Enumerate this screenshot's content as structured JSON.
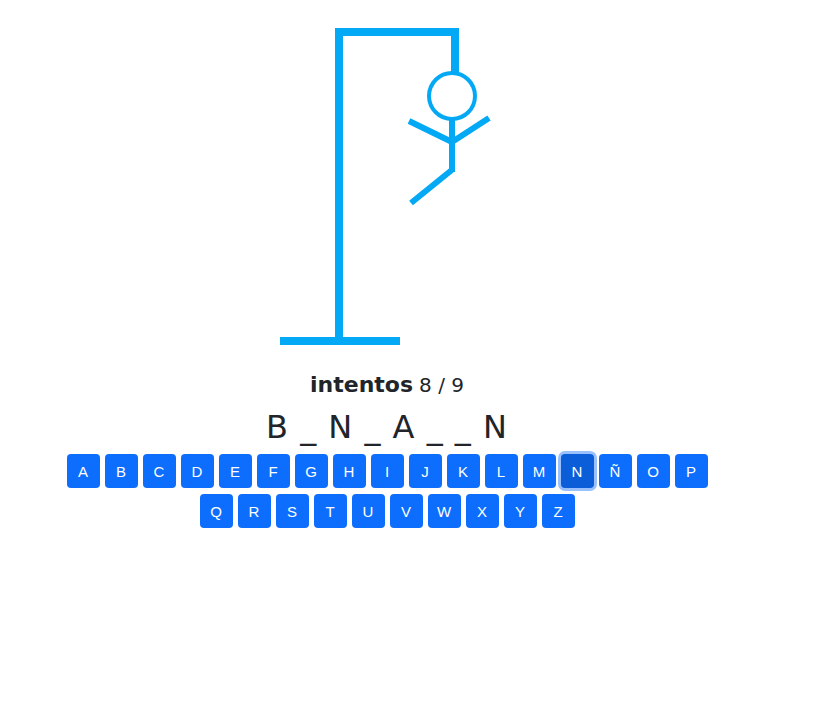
{
  "hangman": {
    "parts": [
      {
        "name": "head",
        "drawn": true
      },
      {
        "name": "body",
        "drawn": true
      },
      {
        "name": "left-arm",
        "drawn": true
      },
      {
        "name": "right-arm",
        "drawn": true
      },
      {
        "name": "left-leg",
        "drawn": true
      },
      {
        "name": "right-leg",
        "drawn": false
      }
    ]
  },
  "attempts": {
    "label": "intentos",
    "count": "8 / 9"
  },
  "word": "B _ N _ A _ _ N",
  "keyboard": {
    "rows": [
      [
        {
          "letter": "A",
          "selected": false
        },
        {
          "letter": "B",
          "selected": false
        },
        {
          "letter": "C",
          "selected": false
        },
        {
          "letter": "D",
          "selected": false
        },
        {
          "letter": "E",
          "selected": false
        },
        {
          "letter": "F",
          "selected": false
        },
        {
          "letter": "G",
          "selected": false
        },
        {
          "letter": "H",
          "selected": false
        },
        {
          "letter": "I",
          "selected": false
        },
        {
          "letter": "J",
          "selected": false
        },
        {
          "letter": "K",
          "selected": false
        },
        {
          "letter": "L",
          "selected": false
        },
        {
          "letter": "M",
          "selected": false
        },
        {
          "letter": "N",
          "selected": true
        },
        {
          "letter": "Ñ",
          "selected": false
        },
        {
          "letter": "O",
          "selected": false
        },
        {
          "letter": "P",
          "selected": false
        }
      ],
      [
        {
          "letter": "Q",
          "selected": false
        },
        {
          "letter": "R",
          "selected": false
        },
        {
          "letter": "S",
          "selected": false
        },
        {
          "letter": "T",
          "selected": false
        },
        {
          "letter": "U",
          "selected": false
        },
        {
          "letter": "V",
          "selected": false
        },
        {
          "letter": "W",
          "selected": false
        },
        {
          "letter": "X",
          "selected": false
        },
        {
          "letter": "Y",
          "selected": false
        },
        {
          "letter": "Z",
          "selected": false
        }
      ]
    ]
  }
}
